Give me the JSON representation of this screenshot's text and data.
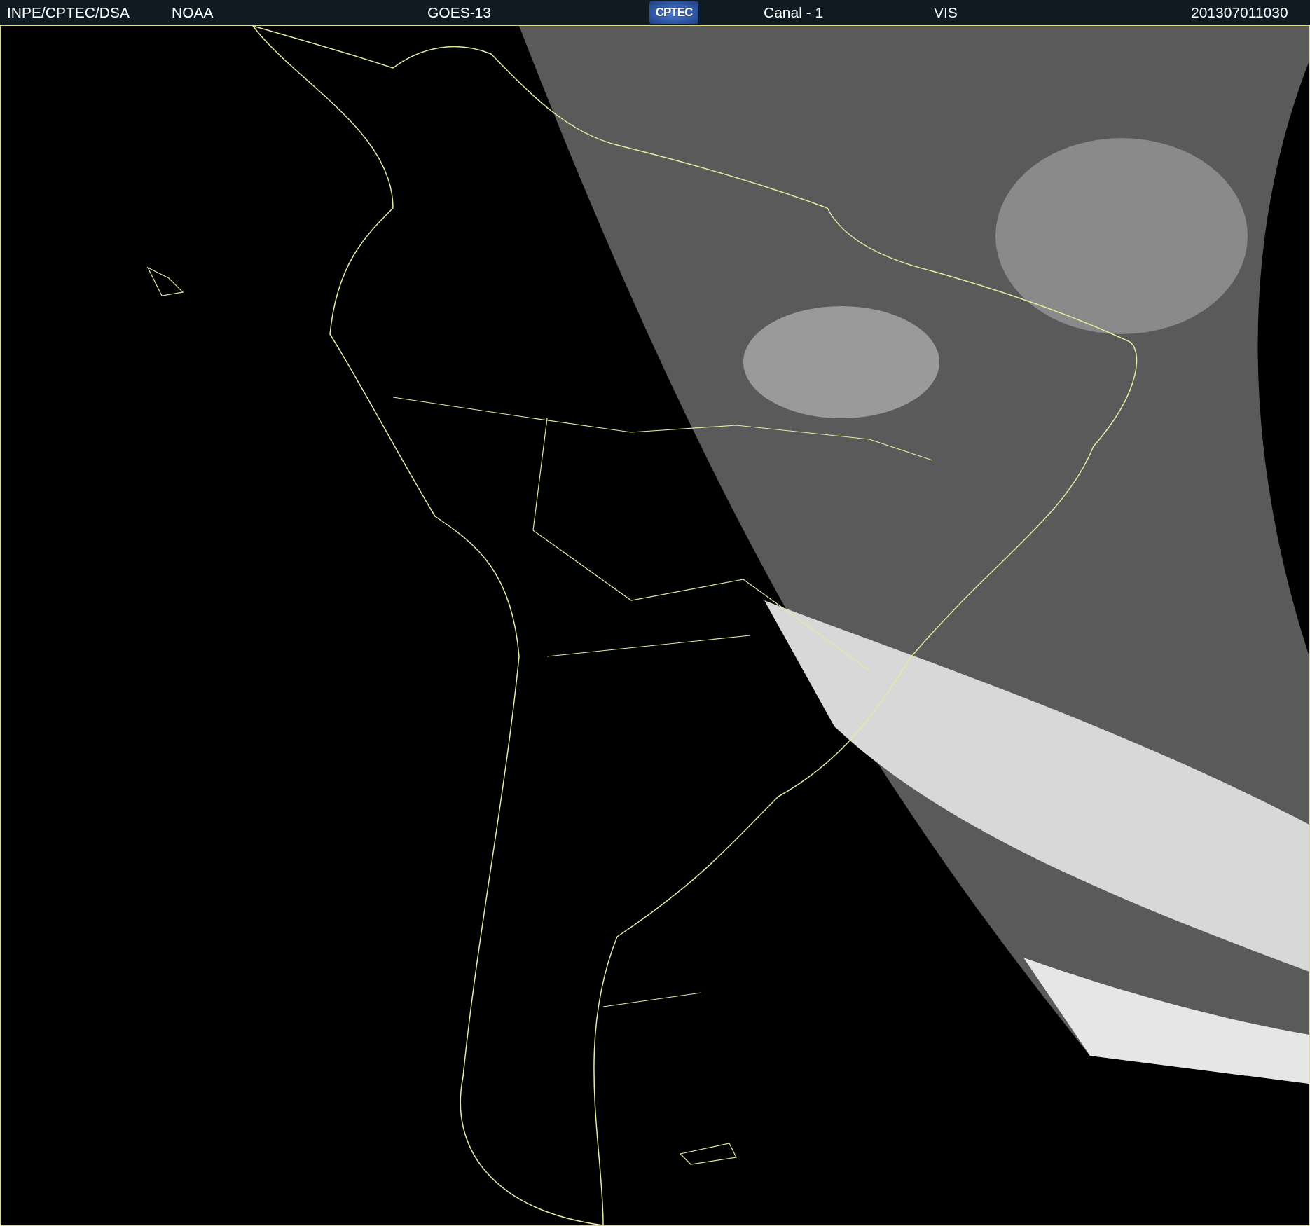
{
  "header": {
    "source": "INPE/CPTEC/DSA",
    "agency": "NOAA",
    "satellite": "GOES-13",
    "logo": "CPTEC",
    "channel": "Canal - 1",
    "band": "VIS",
    "timestamp": "201307011030"
  }
}
